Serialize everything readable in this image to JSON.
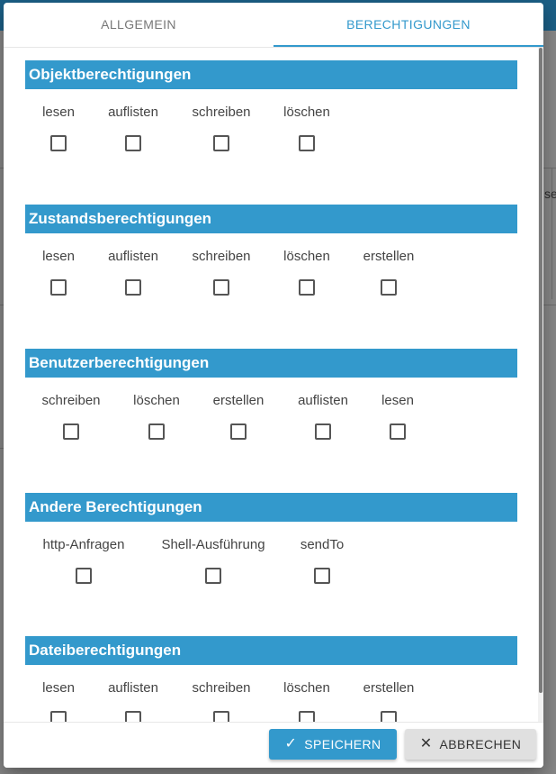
{
  "tabs": [
    {
      "label": "ALLGEMEIN"
    },
    {
      "label": "BERECHTIGUNGEN"
    }
  ],
  "background": {
    "frag1": "se"
  },
  "sections": [
    {
      "title": "Objektberechtigungen",
      "perms": [
        "lesen",
        "auflisten",
        "schreiben",
        "löschen"
      ]
    },
    {
      "title": "Zustandsberechtigungen",
      "perms": [
        "lesen",
        "auflisten",
        "schreiben",
        "löschen",
        "erstellen"
      ]
    },
    {
      "title": "Benutzerberechtigungen",
      "perms": [
        "schreiben",
        "löschen",
        "erstellen",
        "auflisten",
        "lesen"
      ]
    },
    {
      "title": "Andere Berechtigungen",
      "perms": [
        "http-Anfragen",
        "Shell-Ausführung",
        "sendTo"
      ]
    },
    {
      "title": "Dateiberechtigungen",
      "perms": [
        "lesen",
        "auflisten",
        "schreiben",
        "löschen",
        "erstellen"
      ]
    }
  ],
  "footer": {
    "save_label": "SPEICHERN",
    "save_icon": "check-icon",
    "cancel_label": "ABBRECHEN",
    "cancel_icon": "close-icon"
  },
  "colors": {
    "accent": "#3399cc"
  }
}
